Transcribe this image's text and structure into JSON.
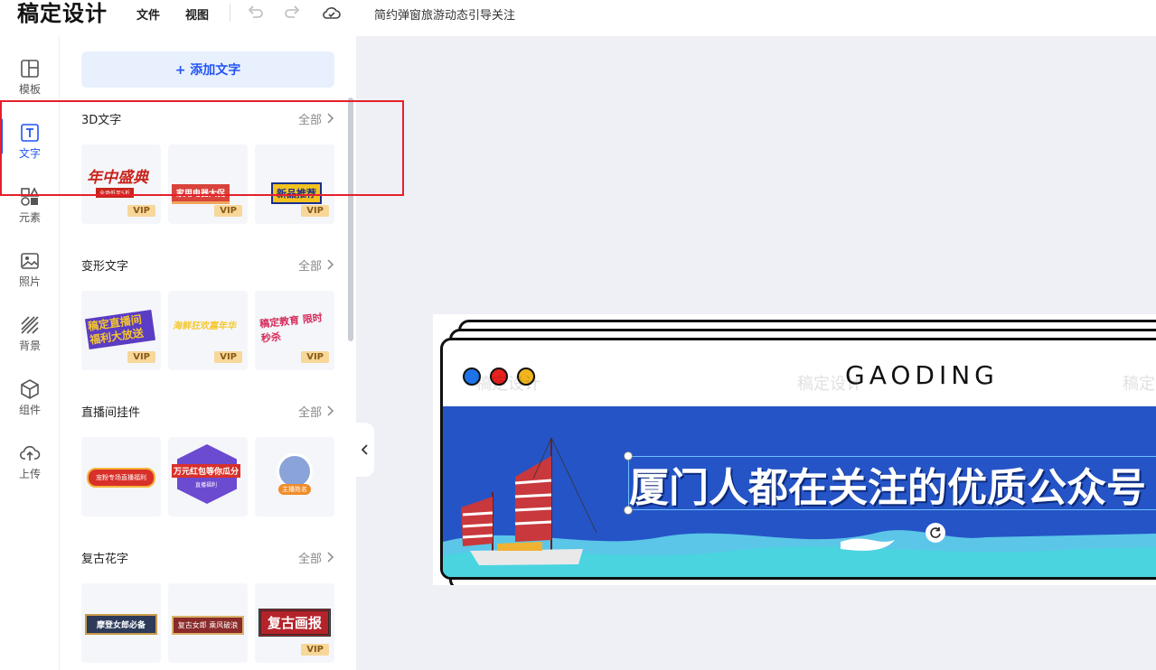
{
  "app": {
    "logo": "稿定设计",
    "doc_title": "简约弹窗旅游动态引导关注"
  },
  "menu": {
    "file": "文件",
    "view": "视图"
  },
  "toolbar": {
    "undo_icon": "undo-icon",
    "redo_icon": "redo-icon",
    "cloud_icon": "cloud-icon"
  },
  "rail": {
    "items": [
      {
        "label": "模板",
        "icon": "template-icon"
      },
      {
        "label": "文字",
        "icon": "text-icon",
        "active": true
      },
      {
        "label": "元素",
        "icon": "shapes-icon"
      },
      {
        "label": "照片",
        "icon": "photo-icon"
      },
      {
        "label": "背景",
        "icon": "background-icon"
      },
      {
        "label": "组件",
        "icon": "cube-icon"
      },
      {
        "label": "上传",
        "icon": "upload-icon"
      }
    ]
  },
  "panel": {
    "add_text": "+ 添加文字",
    "all_label": "全部",
    "vip": "VIP",
    "sections": [
      {
        "title": "3D文字",
        "thumbs": [
          {
            "text": "年中盛典",
            "sub": "全场低至5折",
            "vip": true
          },
          {
            "text": "家用电器大促",
            "vip": true
          },
          {
            "text": "新品推荐",
            "vip": true
          }
        ]
      },
      {
        "title": "变形文字",
        "thumbs": [
          {
            "text": "稿定直播间 福利大放送",
            "vip": true
          },
          {
            "text": "海鲜狂欢嘉年华",
            "vip": true
          },
          {
            "text": "稿定教育 限时秒杀",
            "vip": true
          }
        ]
      },
      {
        "title": "直播间挂件",
        "thumbs": [
          {
            "text": "宠粉专场直播福利",
            "vip": false
          },
          {
            "text": "万元红包等你瓜分",
            "sub": "直播福利",
            "vip": false
          },
          {
            "text": "主播姓名",
            "vip": false
          }
        ]
      },
      {
        "title": "复古花字",
        "thumbs": [
          {
            "text": "摩登女郎必备",
            "vip": false
          },
          {
            "text": "复古女郎 乘风破浪",
            "vip": false
          },
          {
            "text": "复古画报",
            "vip": true
          }
        ]
      }
    ]
  },
  "canvas": {
    "brand": "GAODING",
    "watermark": "稿定设计",
    "headline": "厦门人都在关注的优质公众号",
    "dots": [
      "#1e73e8",
      "#e8221e",
      "#f0b51e"
    ],
    "banner_color": "#2554c7"
  },
  "colors": {
    "accent": "#2254f4",
    "highlight": "#e5202a",
    "vip_bg": "#f7d79a"
  }
}
